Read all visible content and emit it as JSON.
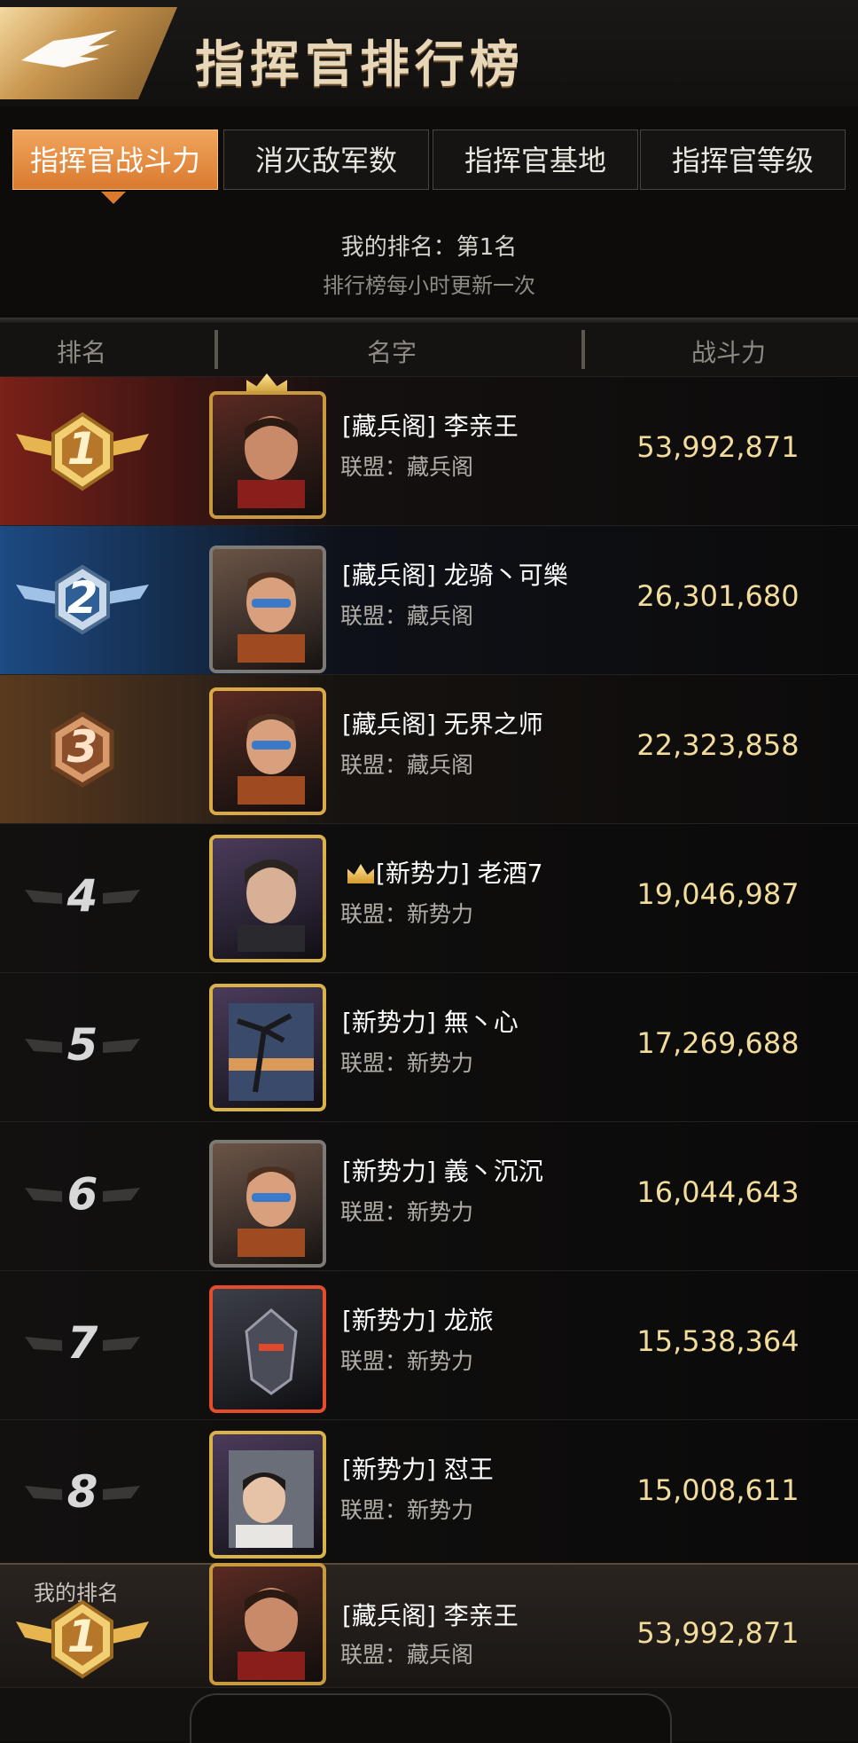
{
  "header": {
    "title": "指挥官排行榜",
    "logo_icon": "eagle-emblem-icon"
  },
  "tabs": [
    {
      "label": "指挥官战斗力",
      "active": true
    },
    {
      "label": "消灭敌军数",
      "active": false
    },
    {
      "label": "指挥官基地",
      "active": false
    },
    {
      "label": "指挥官等级",
      "active": false
    }
  ],
  "my_rank": {
    "text": "我的排名：第1名",
    "update_note": "排行榜每小时更新一次"
  },
  "columns": {
    "rank": "排名",
    "name": "名字",
    "power": "战斗力"
  },
  "rows": [
    {
      "rank": "1",
      "name": "[藏兵阁] 李亲王",
      "alliance": "联盟：藏兵阁",
      "power": "53,992,871"
    },
    {
      "rank": "2",
      "name": "[藏兵阁] 龙骑丶可樂",
      "alliance": "联盟：藏兵阁",
      "power": "26,301,680"
    },
    {
      "rank": "3",
      "name": "[藏兵阁] 无界之师",
      "alliance": "联盟：藏兵阁",
      "power": "22,323,858"
    },
    {
      "rank": "4",
      "name": "[新势力] 老酒7",
      "alliance": "联盟：新势力",
      "power": "19,046,987"
    },
    {
      "rank": "5",
      "name": "[新势力] 無丶心",
      "alliance": "联盟：新势力",
      "power": "17,269,688"
    },
    {
      "rank": "6",
      "name": "[新势力] 義丶沉沉",
      "alliance": "联盟：新势力",
      "power": "16,044,643"
    },
    {
      "rank": "7",
      "name": "[新势力] 龙旅",
      "alliance": "联盟：新势力",
      "power": "15,538,364"
    },
    {
      "rank": "8",
      "name": "[新势力] 怼王",
      "alliance": "联盟：新势力",
      "power": "15,008,611"
    }
  ],
  "my_row": {
    "label": "我的排名",
    "rank": "1",
    "name": "[藏兵阁] 李亲王",
    "alliance": "联盟：藏兵阁",
    "power": "53,992,871"
  },
  "colors": {
    "accent_orange": "#e08a3c",
    "power_gold": "#f1dc9c",
    "rank1_red": "#7a2118",
    "rank2_blue": "#1d4a82",
    "rank3_bronze": "#5a3a1e"
  }
}
